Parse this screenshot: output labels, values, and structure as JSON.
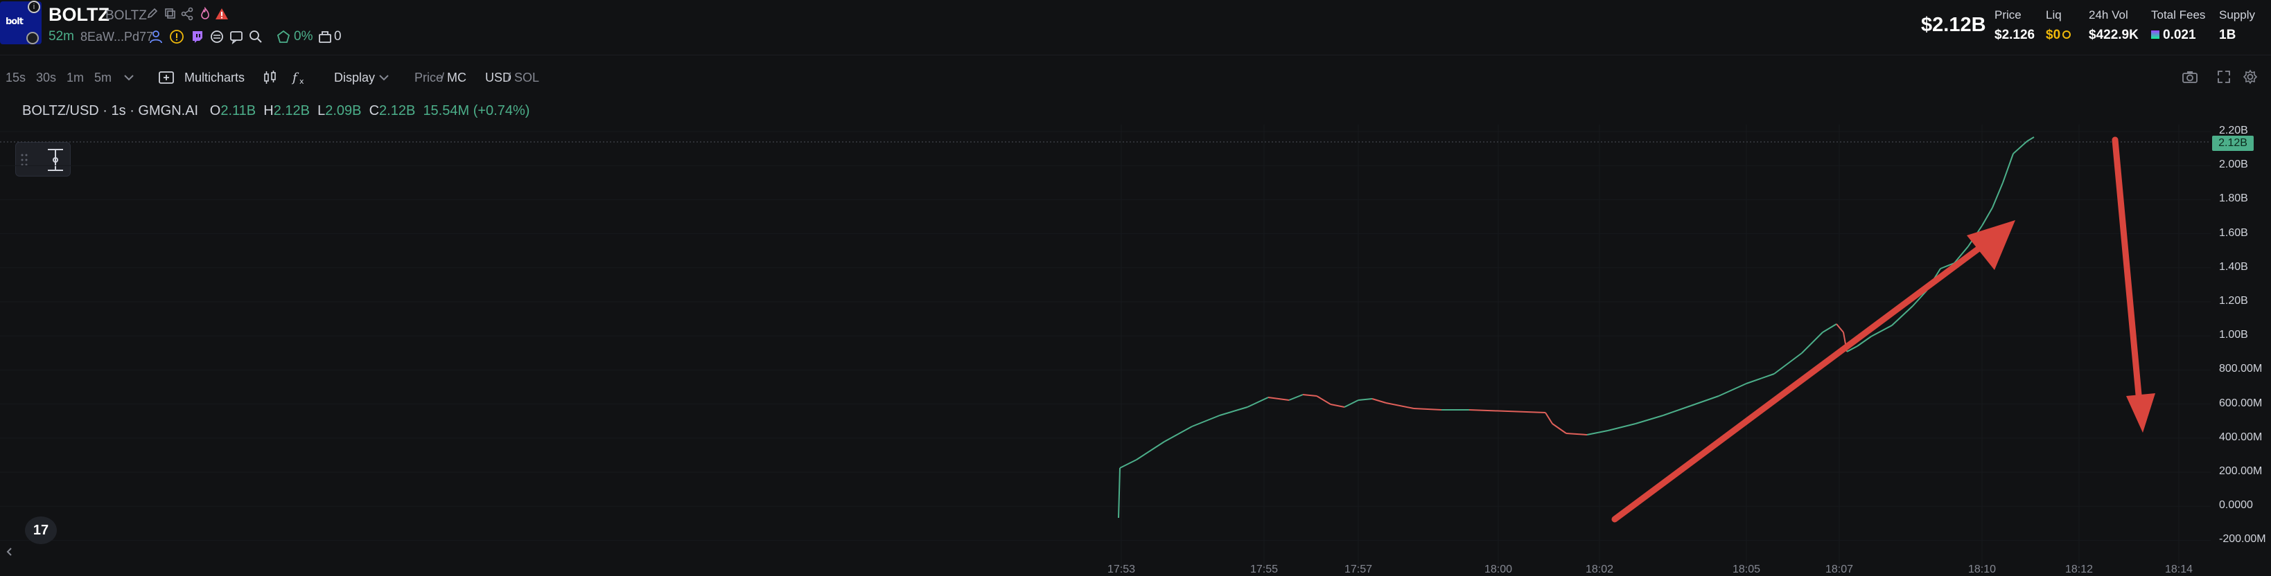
{
  "token": {
    "logo_text": "bolt",
    "name": "BOLTZ",
    "symbol": "BOLTZ",
    "age": "52m",
    "address": "8EaW...Pd77",
    "holder_pct": "0%",
    "bundle_count": "0"
  },
  "stats": {
    "market_cap": "$2.12B",
    "price_label": "Price",
    "price_value": "$2.126",
    "liq_label": "Liq",
    "liq_value": "$0",
    "vol_label": "24h Vol",
    "vol_value": "$422.9K",
    "fees_label": "Total Fees",
    "fees_value": "0.021",
    "supply_label": "Supply",
    "supply_value": "1B"
  },
  "toolbar": {
    "intervals": [
      "15s",
      "30s",
      "1m",
      "5m"
    ],
    "multicharts": "Multicharts",
    "display": "Display",
    "price_label": "Price",
    "mc_label": "MC",
    "usd_label": "USD",
    "sol_label": "SOL"
  },
  "legend": {
    "symbol": "BOLTZ/USD · 1s · GMGN.AI",
    "o_label": "O",
    "o_value": "2.11B",
    "h_label": "H",
    "h_value": "2.12B",
    "l_label": "L",
    "l_value": "2.09B",
    "c_label": "C",
    "c_value": "2.12B",
    "change": "15.54M (+0.74%)"
  },
  "y_axis": [
    "2.20B",
    "2.00B",
    "1.80B",
    "1.60B",
    "1.40B",
    "1.20B",
    "1.00B",
    "800.00M",
    "600.00M",
    "400.00M",
    "200.00M",
    "0.0000",
    "-200.00M"
  ],
  "current_price_tag": "2.12B",
  "x_axis": [
    "17:53",
    "17:55",
    "17:57",
    "18:00",
    "18:02",
    "18:05",
    "18:07",
    "18:10",
    "18:12",
    "18:14"
  ],
  "colors": {
    "up": "#4caf8a",
    "down": "#e0605a",
    "arrow": "#d9453d",
    "background": "#111214"
  },
  "icons": {
    "tv_logo": "17"
  }
}
